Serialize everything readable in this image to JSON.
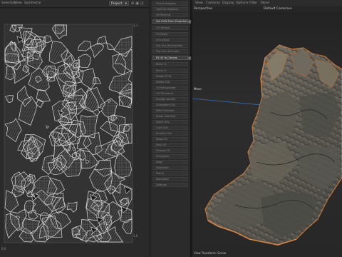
{
  "uv_editor": {
    "menus": [
      "Selection",
      "View",
      "Symmetry"
    ],
    "dropdown_value": "Project",
    "corner_top_left": "",
    "corner_top_right": "1,1",
    "corner_bottom_right": "1,0",
    "corner_bottom_left": "0,0"
  },
  "tools": [
    {
      "label": "Select Polygons",
      "highlight": false
    },
    {
      "label": "Optimal Mapping",
      "highlight": false
    },
    {
      "label": "UV Packing",
      "highlight": false
    },
    {
      "label": "Set UVW From Projection",
      "highlight": true
    },
    {
      "label": "UV Terrace",
      "highlight": false
    },
    {
      "label": "UV Relax",
      "highlight": false
    },
    {
      "label": "UV Layout",
      "highlight": false
    },
    {
      "label": "Flip UVs Horizontally",
      "highlight": false
    },
    {
      "label": "Flip UVs Vertically",
      "highlight": false
    },
    {
      "label": "Fit UV to Canvas",
      "highlight": true
    },
    {
      "label": "Mirror U",
      "highlight": false
    },
    {
      "label": "Mirror V",
      "highlight": false
    },
    {
      "label": "Rotate CCW",
      "highlight": false
    },
    {
      "label": "Rotate CW",
      "highlight": false
    },
    {
      "label": "UV Manipulator",
      "highlight": false
    },
    {
      "label": "UV Transform",
      "highlight": false
    },
    {
      "label": "Realign Islands",
      "highlight": false
    },
    {
      "label": "Straighten UVs",
      "highlight": false
    },
    {
      "label": "Weld Selected",
      "highlight": false
    },
    {
      "label": "Break Selected",
      "highlight": false
    },
    {
      "label": "Stitch UVs",
      "highlight": false
    },
    {
      "label": "Grab UVs",
      "highlight": false
    },
    {
      "label": "Smooth UVs",
      "highlight": false
    },
    {
      "label": "Relax UV",
      "highlight": false
    },
    {
      "label": "Pack UV",
      "highlight": false
    },
    {
      "label": "Unwrap UV",
      "highlight": false
    },
    {
      "label": "Straighten",
      "highlight": false
    },
    {
      "label": "Align",
      "highlight": false
    },
    {
      "label": "Distribute",
      "highlight": false
    },
    {
      "label": "Match",
      "highlight": false
    },
    {
      "label": "Normalize",
      "highlight": false
    },
    {
      "label": "Settings",
      "highlight": false
    }
  ],
  "viewport": {
    "menus": [
      "View",
      "Cameras",
      "Display",
      "Options",
      "Filter",
      "Panel"
    ],
    "view_name": "Perspective",
    "camera_name": "Default Camera",
    "axis_label": "Move",
    "footer": "View Transform: Scene"
  },
  "colors": {
    "accent_orange": "#c77a3a",
    "wire": "#dcdcdc",
    "highlight_button": "#3d3d3d"
  }
}
